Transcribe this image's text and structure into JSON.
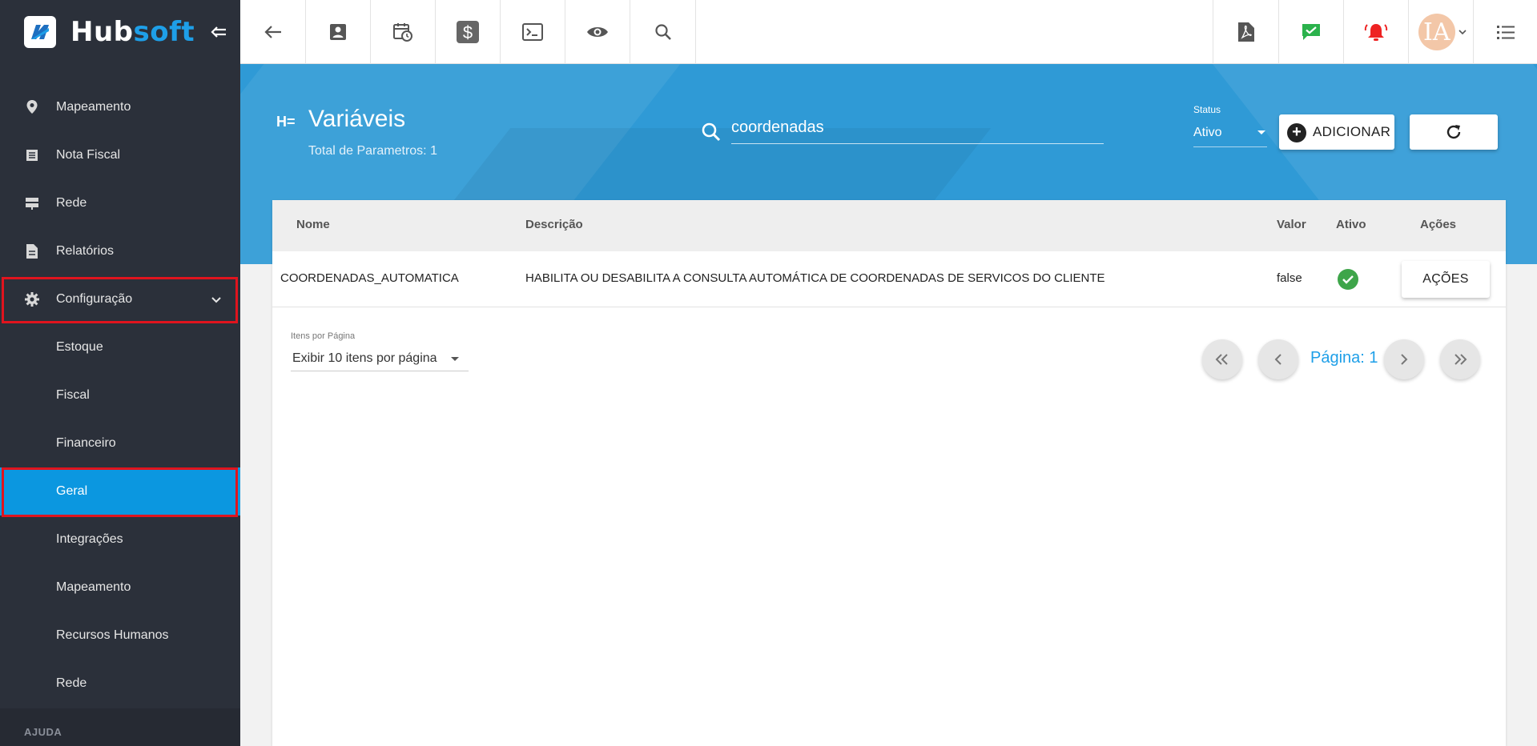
{
  "app": {
    "logo_hub": "Hub",
    "logo_soft": "soft"
  },
  "sidebar": {
    "items": [
      {
        "label": "Mapeamento",
        "icon": "map-pin-icon"
      },
      {
        "label": "Nota Fiscal",
        "icon": "receipt-icon"
      },
      {
        "label": "Rede",
        "icon": "network-icon"
      },
      {
        "label": "Relatórios",
        "icon": "report-icon"
      },
      {
        "label": "Configuração",
        "icon": "gear-icon"
      }
    ],
    "subitems": [
      {
        "label": "Estoque"
      },
      {
        "label": "Fiscal"
      },
      {
        "label": "Financeiro"
      },
      {
        "label": "Geral"
      },
      {
        "label": "Integrações"
      },
      {
        "label": "Mapeamento"
      },
      {
        "label": "Recursos Humanos"
      },
      {
        "label": "Rede"
      }
    ],
    "help_label": "AJUDA"
  },
  "header": {
    "title": "Variáveis",
    "subtitle": "Total de Parametros: 1",
    "search_value": "coordenadas",
    "status_label": "Status",
    "status_value": "Ativo",
    "add_label": "ADICIONAR"
  },
  "table": {
    "columns": {
      "nome": "Nome",
      "descricao": "Descrição",
      "valor": "Valor",
      "ativo": "Ativo",
      "acoes": "Ações"
    },
    "rows": [
      {
        "nome": "COORDENADAS_AUTOMATICA",
        "descricao": "HABILITA OU DESABILITA A CONSULTA AUTOMÁTICA DE COORDENADAS DE SERVICOS DO CLIENTE",
        "valor": "false",
        "ativo": true,
        "acoes_label": "AÇÕES"
      }
    ]
  },
  "pagination": {
    "per_page_label": "Itens por Página",
    "per_page_value": "Exibir 10 itens por página",
    "page_label": "Página: 1"
  },
  "colors": {
    "sidebar_bg": "#2b303a",
    "accent": "#0b97e0",
    "header_bg": "#2f9ad6",
    "highlight": "#e0141e",
    "active_check": "#3ea54a",
    "alert_red": "#ee2222",
    "chat_green": "#2bb24c"
  }
}
